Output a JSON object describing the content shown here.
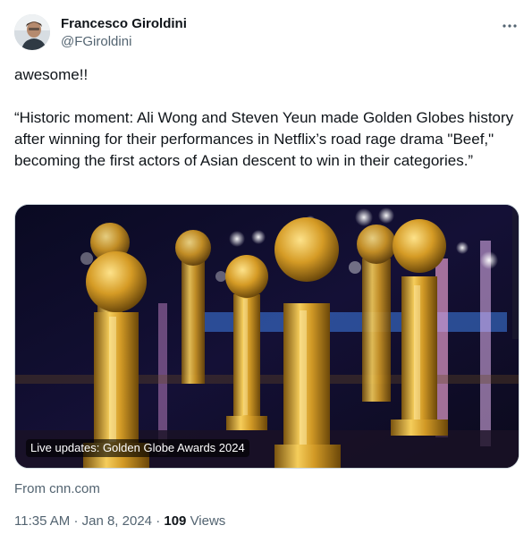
{
  "author": {
    "name": "Francesco Giroldini",
    "handle": "@FGiroldini"
  },
  "icons": {
    "more": "more-horizontal-icon"
  },
  "tweet": {
    "line1": "awesome!!",
    "line2": "“Historic moment: Ali Wong and Steven Yeun made Golden Globes history after winning for their performances in Netflix’s road rage drama \"Beef,\" becoming the first actors of Asian descent to win in their categories.”"
  },
  "card": {
    "caption": "Live updates: Golden Globe Awards 2024",
    "source": "From cnn.com"
  },
  "meta": {
    "time": "11:35 AM",
    "separator": "·",
    "date": "Jan 8, 2024",
    "views_count": "109",
    "views_label": "Views"
  },
  "colors": {
    "text": "#0f1419",
    "secondary": "#536471",
    "border": "#cfd9de"
  }
}
